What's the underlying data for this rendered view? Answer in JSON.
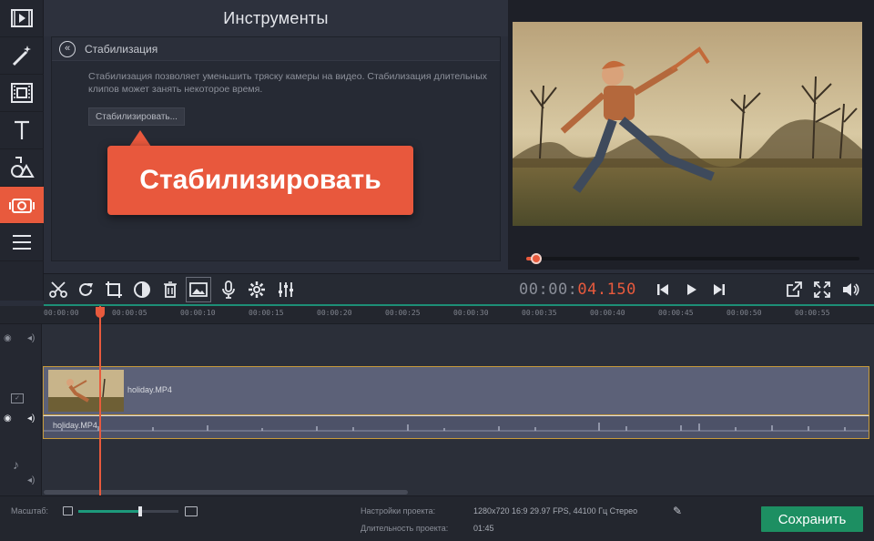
{
  "tools": {
    "title": "Инструменты",
    "panel_title": "Стабилизация",
    "description": "Стабилизация позволяет уменьшить тряску камеры на видео. Стабилизация длительных клипов может занять некоторое время.",
    "stabilize_button": "Стабилизировать..."
  },
  "callout": {
    "text": "Стабилизировать"
  },
  "toolbar": {
    "timecode_dim": "00:00:",
    "timecode_red": "04.150"
  },
  "timeline": {
    "ruler_ticks": [
      "00:00:00",
      "00:00:05",
      "00:00:10",
      "00:00:15",
      "00:00:20",
      "00:00:25",
      "00:00:30",
      "00:00:35",
      "00:00:40",
      "00:00:45",
      "00:00:50",
      "00:00:55"
    ],
    "video_clip_label": "holiday.MP4",
    "audio_clip_label": "holiday.MP4"
  },
  "bottom": {
    "zoom_label": "Масштаб:",
    "settings_label": "Настройки проекта:",
    "settings_value": "1280x720 16:9 29.97 FPS, 44100 Гц Стерео",
    "duration_label": "Длительность проекта:",
    "duration_value": "01:45",
    "save_button": "Сохранить"
  },
  "playback": {
    "position_fraction": 0.03
  },
  "colors": {
    "accent": "#e85a3d",
    "save": "#1d8f62",
    "teal": "#1d8f76"
  },
  "icons": {
    "sidebar": [
      "film-import-icon",
      "magic-wand-icon",
      "film-strip-icon",
      "text-icon",
      "shapes-icon",
      "stabilize-camera-icon",
      "menu-icon"
    ],
    "toolbar": [
      "scissors-icon",
      "rotate-icon",
      "crop-icon",
      "color-icon",
      "trash-icon",
      "image-icon",
      "microphone-icon",
      "gear-icon",
      "equalizer-icon",
      "skip-back-icon",
      "play-icon",
      "skip-forward-icon",
      "export-icon",
      "fullscreen-icon",
      "volume-icon"
    ]
  }
}
